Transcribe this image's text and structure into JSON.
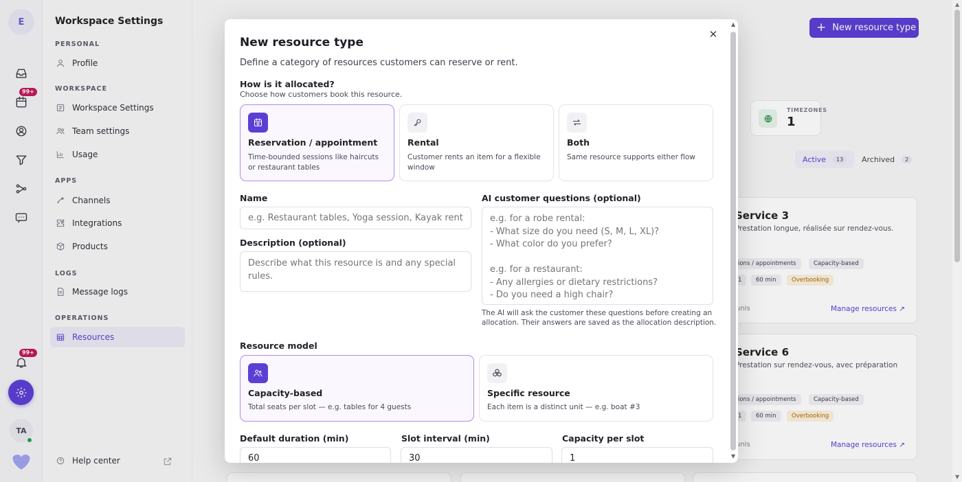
{
  "rail": {
    "workspace_initial": "E",
    "badge_calendar": "99+",
    "badge_notifications": "99+",
    "user_initials": "TA"
  },
  "sidebar": {
    "title": "Workspace Settings",
    "sections": {
      "personal": "PERSONAL",
      "workspace": "WORKSPACE",
      "apps": "APPS",
      "logs": "LOGS",
      "operations": "OPERATIONS"
    },
    "items": {
      "profile": "Profile",
      "workspace_settings": "Workspace Settings",
      "team_settings": "Team settings",
      "usage": "Usage",
      "channels": "Channels",
      "integrations": "Integrations",
      "products": "Products",
      "message_logs": "Message logs",
      "resources": "Resources"
    },
    "help_center": "Help center"
  },
  "background": {
    "new_button": "New resource type",
    "stat": {
      "label": "TIMEZONES",
      "value": "1"
    },
    "tabs": {
      "active": "Active",
      "active_count": "13",
      "archived": "Archived",
      "archived_count": "2"
    },
    "cards": [
      {
        "title": "Service 3",
        "desc": "Prestation longue, réalisée sur rendez-vous.",
        "chip1": "ions / appointments",
        "chip2": "Capacity-based",
        "chip3": "1",
        "chip4": "60 min",
        "chip5": "Overbooking",
        "footer": "unis",
        "manage": "Manage resources"
      },
      {
        "title": "Service 6",
        "desc": "Prestation sur rendez-vous, avec préparation",
        "chip1": "ions / appointments",
        "chip2": "Capacity-based",
        "chip3": "1",
        "chip4": "60 min",
        "chip5": "Overbooking",
        "footer": "unis",
        "manage": "Manage resources"
      }
    ]
  },
  "modal": {
    "title": "New resource type",
    "subtitle": "Define a category of resources customers can reserve or rent.",
    "allocation": {
      "label": "How is it allocated?",
      "help": "Choose how customers book this resource.",
      "options": [
        {
          "name": "Reservation / appointment",
          "desc1": "Time-bounded sessions like haircuts",
          "desc2": "or restaurant tables",
          "icon": "calendar-clock-icon",
          "selected": true
        },
        {
          "name": "Rental",
          "desc1": "Customer rents an item for a flexible",
          "desc2": "window",
          "icon": "key-icon",
          "selected": false
        },
        {
          "name": "Both",
          "desc1": "Same resource supports either flow",
          "desc2": "",
          "icon": "arrows-swap-icon",
          "selected": false
        }
      ]
    },
    "name": {
      "label": "Name",
      "placeholder": "e.g. Restaurant tables, Yoga session, Kayak rental"
    },
    "description": {
      "label": "Description (optional)",
      "placeholder": "Describe what this resource is and any special rules."
    },
    "ai_questions": {
      "label": "AI customer questions (optional)",
      "placeholder": "e.g. for a robe rental:\n- What size do you need (S, M, L, XL)?\n- What color do you prefer?\n\ne.g. for a restaurant:\n- Any allergies or dietary restrictions?\n- Do you need a high chair?",
      "help1": "The AI will ask the customer these questions before creating an",
      "help2": "allocation. Their answers are saved as the allocation description."
    },
    "resource_model": {
      "label": "Resource model",
      "options": [
        {
          "name": "Capacity-based",
          "desc": "Total seats per slot — e.g. tables for 4 guests",
          "icon": "users-icon",
          "selected": true
        },
        {
          "name": "Specific resource",
          "desc": "Each item is a distinct unit — e.g. boat #3",
          "icon": "cubes-icon",
          "selected": false
        }
      ]
    },
    "default_duration": {
      "label": "Default duration (min)",
      "value": "60"
    },
    "slot_interval": {
      "label": "Slot interval (min)",
      "value": "30"
    },
    "capacity": {
      "label": "Capacity per slot",
      "value": "1"
    }
  }
}
